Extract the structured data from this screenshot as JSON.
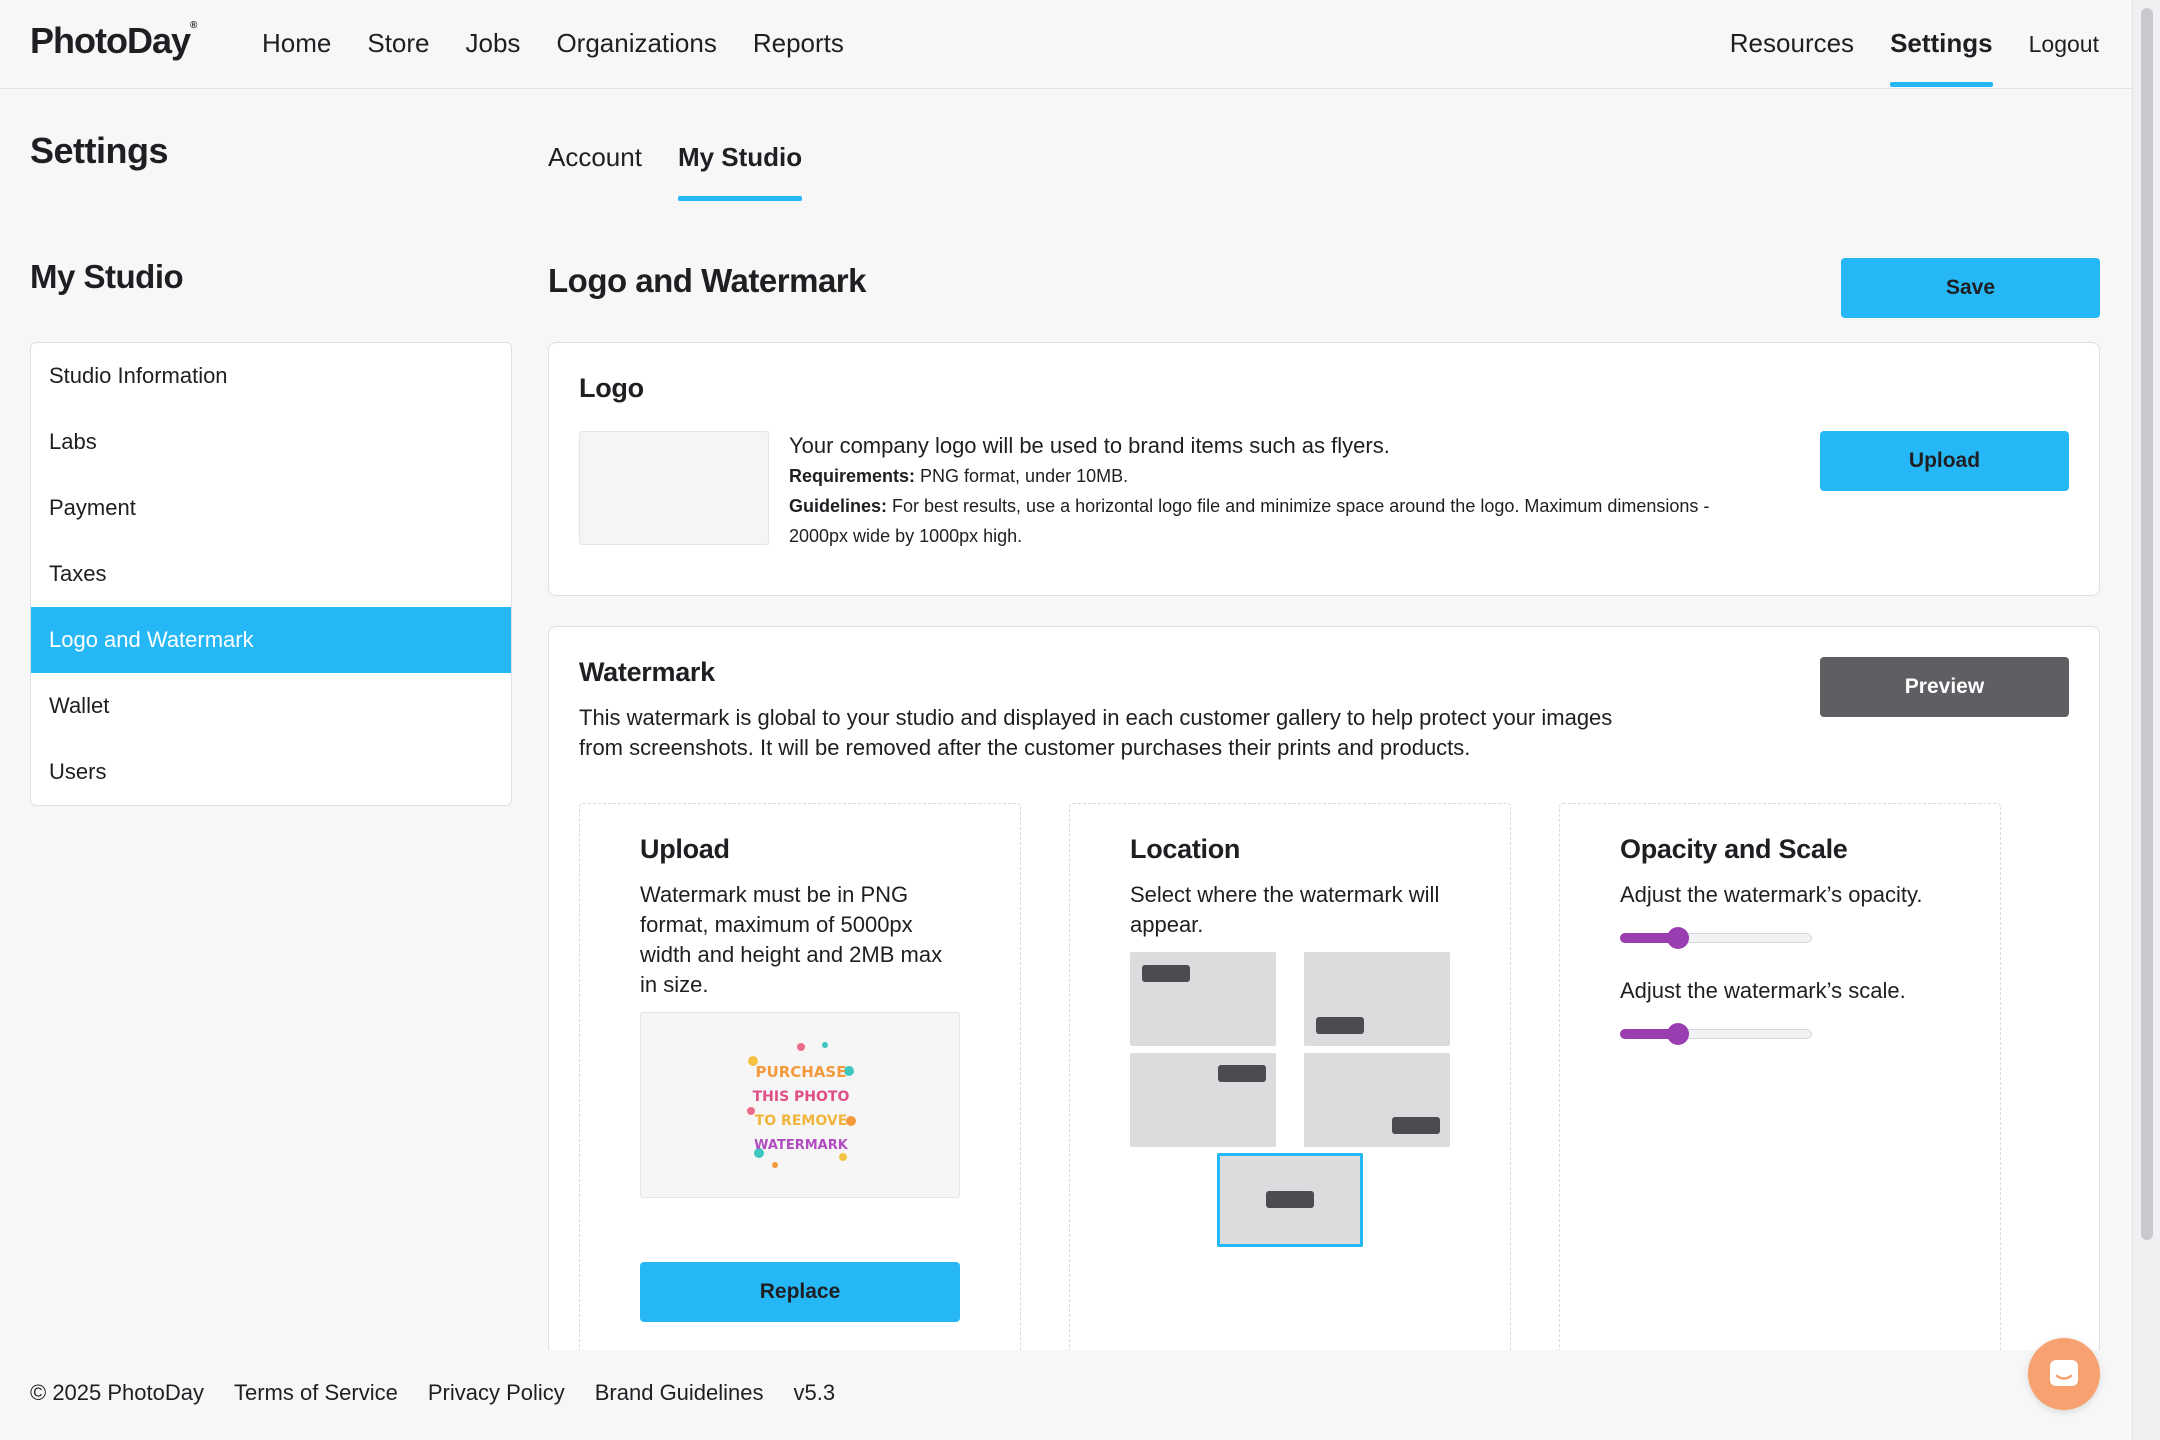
{
  "brand": {
    "name": "PhotoDay",
    "mark": "®"
  },
  "nav": {
    "left": [
      "Home",
      "Store",
      "Jobs",
      "Organizations",
      "Reports"
    ],
    "right": [
      "Resources",
      "Settings",
      "Logout"
    ],
    "active": "Settings"
  },
  "page": {
    "title": "Settings"
  },
  "tabs": [
    {
      "label": "Account"
    },
    {
      "label": "My Studio",
      "active": true
    }
  ],
  "sidebar": {
    "title": "My Studio",
    "items": [
      "Studio Information",
      "Labs",
      "Payment",
      "Taxes",
      "Logo and Watermark",
      "Wallet",
      "Users"
    ],
    "active": "Logo and Watermark"
  },
  "section": {
    "title": "Logo and Watermark",
    "save_label": "Save"
  },
  "logo_card": {
    "title": "Logo",
    "lead": "Your company logo will be used to brand items such as flyers.",
    "req_label": "Requirements:",
    "req_text": " PNG format, under 10MB.",
    "guide_label": "Guidelines:",
    "guide_text": " For best results, use a horizontal logo file and minimize space around the logo. Maximum dimensions - 2000px wide by 1000px high.",
    "upload_label": "Upload"
  },
  "watermark_card": {
    "title": "Watermark",
    "description": "This watermark is global to your studio and displayed in each customer gallery to help protect your images from screenshots. It will be removed after the customer purchases their prints and products.",
    "preview_label": "Preview",
    "upload": {
      "title": "Upload",
      "text": "Watermark must be in PNG format, maximum of 5000px width and height and 2MB max in size.",
      "art_lines": [
        "PURCHASE",
        "THIS PHOTO",
        "TO REMOVE",
        "WATERMARK"
      ],
      "replace_label": "Replace"
    },
    "location": {
      "title": "Location",
      "text": "Select where the watermark will appear.",
      "options": [
        "top-left",
        "bottom-left",
        "top-right",
        "bottom-right",
        "center"
      ],
      "selected": "center"
    },
    "opacity_scale": {
      "title": "Opacity and Scale",
      "opacity_label": "Adjust the watermark’s opacity.",
      "opacity_value": 0.3,
      "scale_label": "Adjust the watermark’s scale.",
      "scale_value": 0.3,
      "accent": "#9a3db0"
    }
  },
  "footer": {
    "copyright": "© 2025 PhotoDay",
    "links": [
      "Terms of Service",
      "Privacy Policy",
      "Brand Guidelines"
    ],
    "version": "v5.3"
  },
  "colors": {
    "accent": "#26b8f6",
    "dark_button": "#5e5e63",
    "chat": "#f7a070"
  },
  "icons": {
    "chat": "chat-bubble-icon"
  }
}
